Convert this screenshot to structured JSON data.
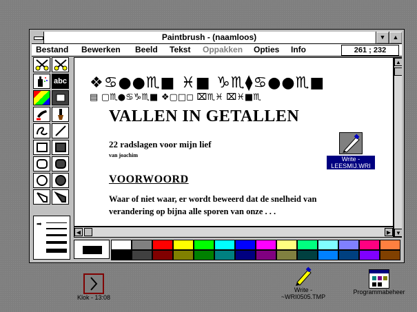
{
  "window": {
    "title": "Paintbrush - (naamloos)",
    "minimize_glyph": "▼",
    "maximize_glyph": "▲"
  },
  "menu": {
    "items": [
      "Bestand",
      "Bewerken",
      "Beeld",
      "Tekst",
      "Oppakken",
      "Opties",
      "Info"
    ],
    "coordinates": "261 ; 232"
  },
  "tools": [
    {
      "name": "scissors-pick-icon"
    },
    {
      "name": "scissors-rect-icon"
    },
    {
      "name": "airbrush-icon"
    },
    {
      "name": "text-tool-icon",
      "label": "abc"
    },
    {
      "name": "color-eraser-icon"
    },
    {
      "name": "eraser-icon"
    },
    {
      "name": "paint-roller-icon"
    },
    {
      "name": "brush-icon"
    },
    {
      "name": "curve-icon"
    },
    {
      "name": "line-icon"
    },
    {
      "name": "box-icon"
    },
    {
      "name": "filled-box-icon"
    },
    {
      "name": "rounded-box-icon"
    },
    {
      "name": "filled-rounded-box-icon"
    },
    {
      "name": "circle-icon"
    },
    {
      "name": "filled-circle-icon"
    },
    {
      "name": "polygon-icon"
    },
    {
      "name": "filled-polygon-icon"
    }
  ],
  "document": {
    "dingbat_line1": "❖♋●●♏■ ♓■ ♑♏⧫♋●●♏■",
    "dingbat_line2": "▤ ▢♏●♋♑♏■ ❖▢□◻ ⌧♏♓ ⌧♓■♏",
    "title": "VALLEN IN GETALLEN",
    "subtitle": "22 radslagen voor mijn lief",
    "author": "van joachim",
    "section": "VOORWOORD",
    "body_line1": "Waar of niet waar, er wordt beweerd dat de snelheid van",
    "body_line2": "verandering op bijna alle sporen van onze . . ."
  },
  "embedded_icon": {
    "label_line1": "Write -",
    "label_line2": "LEESMIJ.WRI"
  },
  "palette": {
    "top": [
      "#ffffff",
      "#808080",
      "#ff0000",
      "#ffff00",
      "#00ff00",
      "#00ffff",
      "#0000ff",
      "#ff00ff",
      "#ffff80",
      "#00ff80",
      "#80ffff",
      "#8080ff",
      "#ff0080",
      "#ff8040"
    ],
    "bottom": [
      "#000000",
      "#404040",
      "#800000",
      "#808000",
      "#008000",
      "#008080",
      "#000080",
      "#800080",
      "#808040",
      "#004040",
      "#0080ff",
      "#004080",
      "#8000ff",
      "#804000"
    ]
  },
  "desktop": {
    "clock_label": "Klok - 13:08",
    "write_label_line1": "Write -",
    "write_label_line2": "~WRI0505.TMP",
    "progman_label": "Programmabeheer"
  },
  "colors": {
    "desktop": "#7f7f7f",
    "selection": "#000080"
  }
}
